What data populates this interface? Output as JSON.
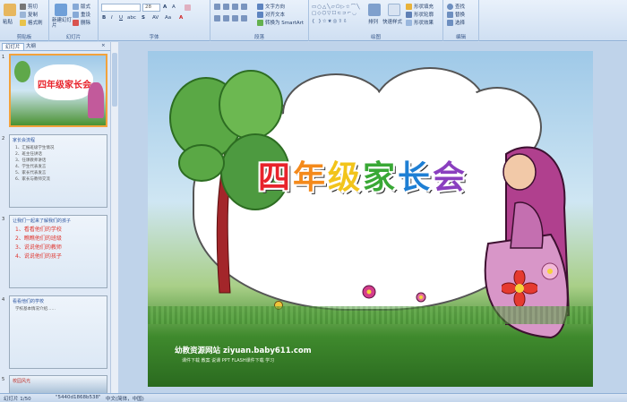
{
  "ribbon": {
    "clipboard": {
      "paste": "粘贴",
      "cut": "剪切",
      "copy": "复制",
      "format_painter": "格式刷",
      "label": "剪贴板"
    },
    "slides": {
      "new_slide": "新建幻灯片",
      "layout": "版式",
      "reset": "重设",
      "delete": "删除",
      "label": "幻灯片"
    },
    "font": {
      "size": "28",
      "label": "字体"
    },
    "paragraph": {
      "text_direction": "文字方向",
      "align_text": "对齐文本",
      "smartart": "转换为 SmartArt",
      "label": "段落"
    },
    "drawing": {
      "arrange": "排列",
      "quick_styles": "快速样式",
      "shape_fill": "形状填充",
      "shape_outline": "形状轮廓",
      "shape_effects": "形状效果",
      "label": "绘图"
    },
    "editing": {
      "find": "查找",
      "replace": "替换",
      "select": "选择",
      "label": "编辑"
    }
  },
  "panel_tabs": {
    "slides": "幻灯片",
    "outline": "大纲"
  },
  "thumbnails": [
    {
      "num": "1",
      "title": "四年级家长会"
    },
    {
      "num": "2",
      "title": "家长会流程",
      "lines": [
        "1、汇报班级学生情况",
        "2、班主任讲话",
        "3、任课教师讲话",
        "4、学生代表发言",
        "5、家长代表发言",
        "6、家长与教师交流"
      ]
    },
    {
      "num": "3",
      "title": "让我们一起来了解我们的孩子",
      "lines": [
        "1、看看他们的学校",
        "2、瞧瞧他们的班级",
        "3、说说他们的教师",
        "4、说说他们的孩子"
      ]
    },
    {
      "num": "4",
      "title": "看看他们的学校",
      "lines": [
        "学校基本情况介绍……"
      ]
    },
    {
      "num": "5",
      "title": "校园风光"
    }
  ],
  "slide": {
    "title": "四年级家长会",
    "website": "幼教资源网站 ziyuan.baby611.com",
    "links": "课件下载  教案  说课  PPT  FLASH课件下载  学习"
  },
  "status": {
    "slide_info": "幻灯片 1/50",
    "theme": "\"5440d1868b538\"",
    "lang": "中文(简体，中国)"
  },
  "colors": {
    "title": [
      "#e8232b",
      "#f48a1c",
      "#f2c41b",
      "#39a835",
      "#1e7fd4",
      "#8a3fbf"
    ]
  }
}
